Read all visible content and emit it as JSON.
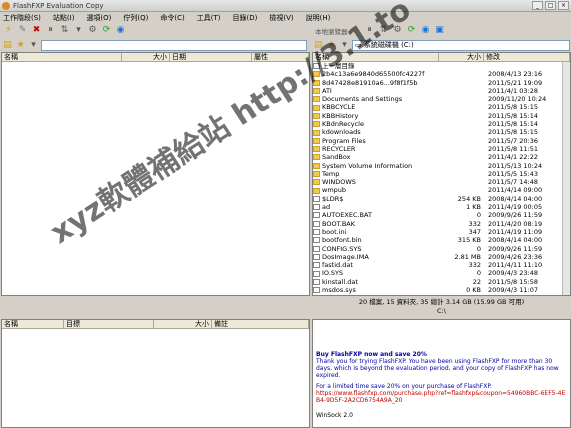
{
  "window": {
    "title": "FlashFXP Evaluation Copy",
    "controls": [
      "_",
      "□",
      "×"
    ]
  },
  "menu": [
    "工作階段(S)",
    "站點(I)",
    "選項(O)",
    "佇列(Q)",
    "命令(C)",
    "工具(T)",
    "目錄(D)",
    "檢視(V)",
    "說明(H)"
  ],
  "right_toolbar_label": "本地瀏覽器",
  "left_header": [
    "名稱",
    "大小",
    "日期",
    "屬性"
  ],
  "right_address": "系統磁碟機 (C:)",
  "right_header": [
    "名稱",
    "大小",
    "修改"
  ],
  "files": [
    {
      "name": "上一層目錄",
      "size": "",
      "date": "",
      "type": "up"
    },
    {
      "name": "2b4c13a6e9840d65500fc4227f",
      "size": "",
      "date": "2008/4/13 23:16",
      "type": "folder"
    },
    {
      "name": "8d47428e81910a6...9f8f1f5b",
      "size": "",
      "date": "2011/5/21 19:09",
      "type": "folder"
    },
    {
      "name": "ATI",
      "size": "",
      "date": "2011/4/1 03:28",
      "type": "folder"
    },
    {
      "name": "Documents and Settings",
      "size": "",
      "date": "2009/11/20 10:24",
      "type": "folder"
    },
    {
      "name": "KBBCYCLE",
      "size": "",
      "date": "2011/5/8 15:15",
      "type": "folder"
    },
    {
      "name": "KBBHistory",
      "size": "",
      "date": "2011/5/8 15:14",
      "type": "folder"
    },
    {
      "name": "KBdnRecycle",
      "size": "",
      "date": "2011/5/8 15:14",
      "type": "folder"
    },
    {
      "name": "kdownloads",
      "size": "",
      "date": "2011/5/8 15:15",
      "type": "folder"
    },
    {
      "name": "Program Files",
      "size": "",
      "date": "2011/5/7 20:36",
      "type": "folder"
    },
    {
      "name": "RECYCLER",
      "size": "",
      "date": "2011/5/8 11:51",
      "type": "folder"
    },
    {
      "name": "SandBox",
      "size": "",
      "date": "2011/4/1 22:22",
      "type": "folder"
    },
    {
      "name": "System Volume Information",
      "size": "",
      "date": "2011/5/13 10:24",
      "type": "folder"
    },
    {
      "name": "Temp",
      "size": "",
      "date": "2011/5/5 15:43",
      "type": "folder"
    },
    {
      "name": "WINDOWS",
      "size": "",
      "date": "2011/5/7 14:48",
      "type": "folder"
    },
    {
      "name": "wmpub",
      "size": "",
      "date": "2011/4/14 09:00",
      "type": "folder"
    },
    {
      "name": "$LDR$",
      "size": "254 KB",
      "date": "2008/4/14 04:00",
      "type": "file"
    },
    {
      "name": "ad",
      "size": "1 KB",
      "date": "2011/4/19 00:05",
      "type": "file"
    },
    {
      "name": "AUTOEXEC.BAT",
      "size": "0",
      "date": "2009/9/26 11:59",
      "type": "file"
    },
    {
      "name": "BOOT.BAK",
      "size": "332",
      "date": "2011/4/20 08:19",
      "type": "file"
    },
    {
      "name": "boot.ini",
      "size": "347",
      "date": "2011/4/19 11:09",
      "type": "file"
    },
    {
      "name": "bootfont.bin",
      "size": "315 KB",
      "date": "2008/4/14 04:00",
      "type": "file"
    },
    {
      "name": "CONFIG.SYS",
      "size": "0",
      "date": "2009/9/26 11:59",
      "type": "file"
    },
    {
      "name": "DosImage.IMA",
      "size": "2.81 MB",
      "date": "2009/4/26 23:36",
      "type": "file"
    },
    {
      "name": "fastid.dat",
      "size": "332",
      "date": "2011/4/11 11:10",
      "type": "file"
    },
    {
      "name": "IO.SYS",
      "size": "0",
      "date": "2009/4/3 23:48",
      "type": "file"
    },
    {
      "name": "kinstall.dat",
      "size": "22",
      "date": "2011/5/8 15:58",
      "type": "file"
    },
    {
      "name": "msdos.sys",
      "size": "0 KB",
      "date": "2009/4/3 11:07",
      "type": "file"
    }
  ],
  "status": {
    "line1": "20 檔案, 15 資料夾, 35 總計 3.14 GB (15.99 GB 可用)",
    "line2": "C:\\"
  },
  "queue_header": [
    "名稱",
    "目標",
    "大小",
    "備註"
  ],
  "log": {
    "heading": "Buy FlashFXP now and save 20%",
    "line1": "Thank you for trying FlashFXP. You have been using FlashFXP for more than 30 days, which is beyond the evaluation period, and your copy of FlashFXP has now expired.",
    "line2": "For a limited time save 20% on your purchase of FlashFXP.",
    "link": "https://www.flashfxp.com/purchase.php?ref=flashfxp&coupon=54960BBC-6EF5-4EB4-9D5F-2A2CD6754A9A_20",
    "footer": "WinSock 2.0"
  },
  "watermark": "xyz軟體補給站 http://3.1.to"
}
